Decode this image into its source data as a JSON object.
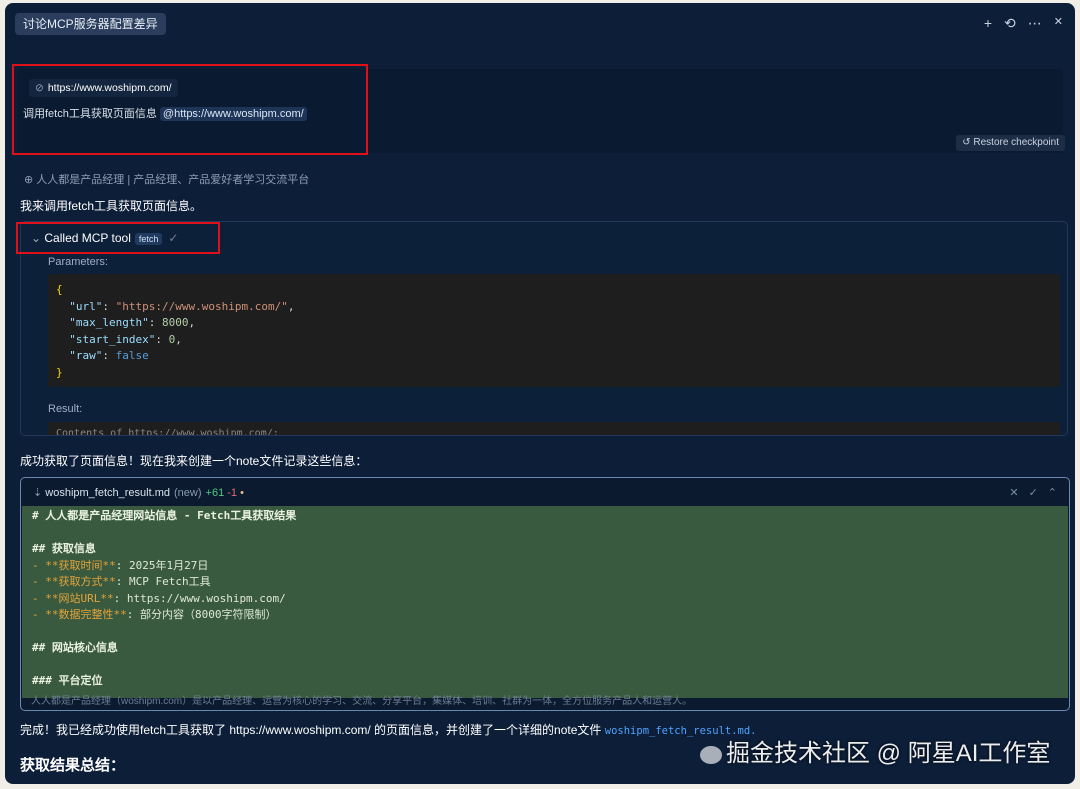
{
  "tab": {
    "title": "讨论MCP服务器配置差异"
  },
  "tab_actions": [
    "+",
    "⟲",
    "⋯",
    "✕"
  ],
  "user_message": {
    "context_chip": "https://www.woshipm.com/",
    "text": "调用fetch工具获取页面信息",
    "mention": "@https://www.woshipm.com/"
  },
  "restore_button": "Restore checkpoint",
  "site_link": "人人都是产品经理 | 产品经理、产品爱好者学习交流平台",
  "intro": "我来调用fetch工具获取页面信息。",
  "tool_call": {
    "label": "Called MCP tool",
    "tag": "fetch",
    "check": "✓",
    "parameters_label": "Parameters:",
    "result_label": "Result:",
    "result_peek": "Contents of https://www.woshipm.com/:"
  },
  "params": {
    "url_key": "\"url\"",
    "url_val": "\"https://www.woshipm.com/\"",
    "ml_key": "\"max_length\"",
    "ml_val": "8000",
    "si_key": "\"start_index\"",
    "si_val": "0",
    "raw_key": "\"raw\"",
    "raw_val": "false"
  },
  "success_msg": "成功获取了页面信息！现在我来创建一个note文件记录这些信息：",
  "diff": {
    "filename": "woshipm_fetch_result.md",
    "status": "(new)",
    "added": "+61",
    "removed": "-1",
    "dot": "•",
    "lines": [
      "# 人人都是产品经理网站信息 - Fetch工具获取结果",
      "",
      "## 获取信息",
      "- **获取时间**: 2025年1月27日",
      "- **获取方式**: MCP Fetch工具",
      "- **网站URL**: https://www.woshipm.com/",
      "- **数据完整性**: 部分内容（8000字符限制）",
      "",
      "## 网站核心信息",
      "",
      "### 平台定位"
    ],
    "under_line": "人人都是产品经理（woshipm.com）是以产品经理、运营为核心的学习、交流、分享平台，集媒体、培训、社群为一体，全方位服务产品人和运营人。"
  },
  "done": {
    "text": "完成！我已经成功使用fetch工具获取了 https://www.woshipm.com/ 的页面信息，并创建了一个详细的note文件",
    "file": "woshipm_fetch_result.md."
  },
  "summary_heading": "获取结果总结：",
  "watermark": "掘金技术社区 @ 阿星AI工作室"
}
